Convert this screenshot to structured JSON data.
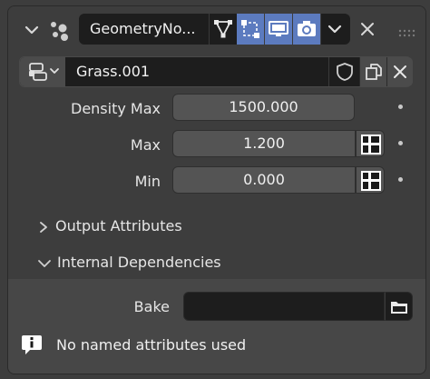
{
  "header": {
    "modifier_name": "GeometryNo..."
  },
  "node_group": {
    "name": "Grass.001"
  },
  "properties": [
    {
      "label": "Density Max",
      "value": "1500.000",
      "has_attribute_toggle": false
    },
    {
      "label": "Max",
      "value": "1.200",
      "has_attribute_toggle": true
    },
    {
      "label": "Min",
      "value": "0.000",
      "has_attribute_toggle": true
    }
  ],
  "subpanels": {
    "output_attributes": {
      "label": "Output Attributes",
      "expanded": false
    },
    "internal_dependencies": {
      "label": "Internal Dependencies",
      "expanded": true
    }
  },
  "bake": {
    "label": "Bake",
    "path_value": ""
  },
  "info": {
    "message": "No named attributes used"
  },
  "colors": {
    "panel_bg": "#3d3d3d",
    "field_bg": "#545454",
    "dark_field_bg": "#1d1d1d",
    "active_toggle": "#5c7bbf"
  }
}
